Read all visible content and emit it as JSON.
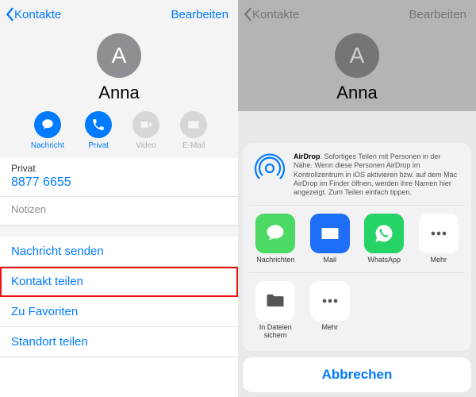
{
  "nav": {
    "back": "Kontakte",
    "edit": "Bearbeiten"
  },
  "contact": {
    "initial": "A",
    "name": "Anna",
    "actions": {
      "message": "Nachricht",
      "call": "Privat",
      "video": "Video",
      "mail": "E-Mail"
    },
    "phone": {
      "label": "Privat",
      "value": "8877 6655"
    },
    "notes_label": "Notizen",
    "rows": {
      "send_message": "Nachricht senden",
      "share_contact": "Kontakt teilen",
      "add_fav": "Zu Favoriten",
      "share_location": "Standort teilen"
    }
  },
  "sheet": {
    "airdrop": {
      "title": "AirDrop",
      "body": ". Sofortiges Teilen mit Personen in der Nähe. Wenn diese Personen AirDrop im Kontrollzentrum in iOS aktivieren bzw. auf dem Mac AirDrop im Finder öffnen, werden ihre Namen hier angezeigt. Zum Teilen einfach tippen."
    },
    "apps": {
      "messages": "Nachrichten",
      "mail": "Mail",
      "whatsapp": "WhatsApp",
      "more": "Mehr"
    },
    "actions": {
      "save_files": "In Dateien sichern",
      "more": "Mehr"
    },
    "cancel": "Abbrechen"
  }
}
